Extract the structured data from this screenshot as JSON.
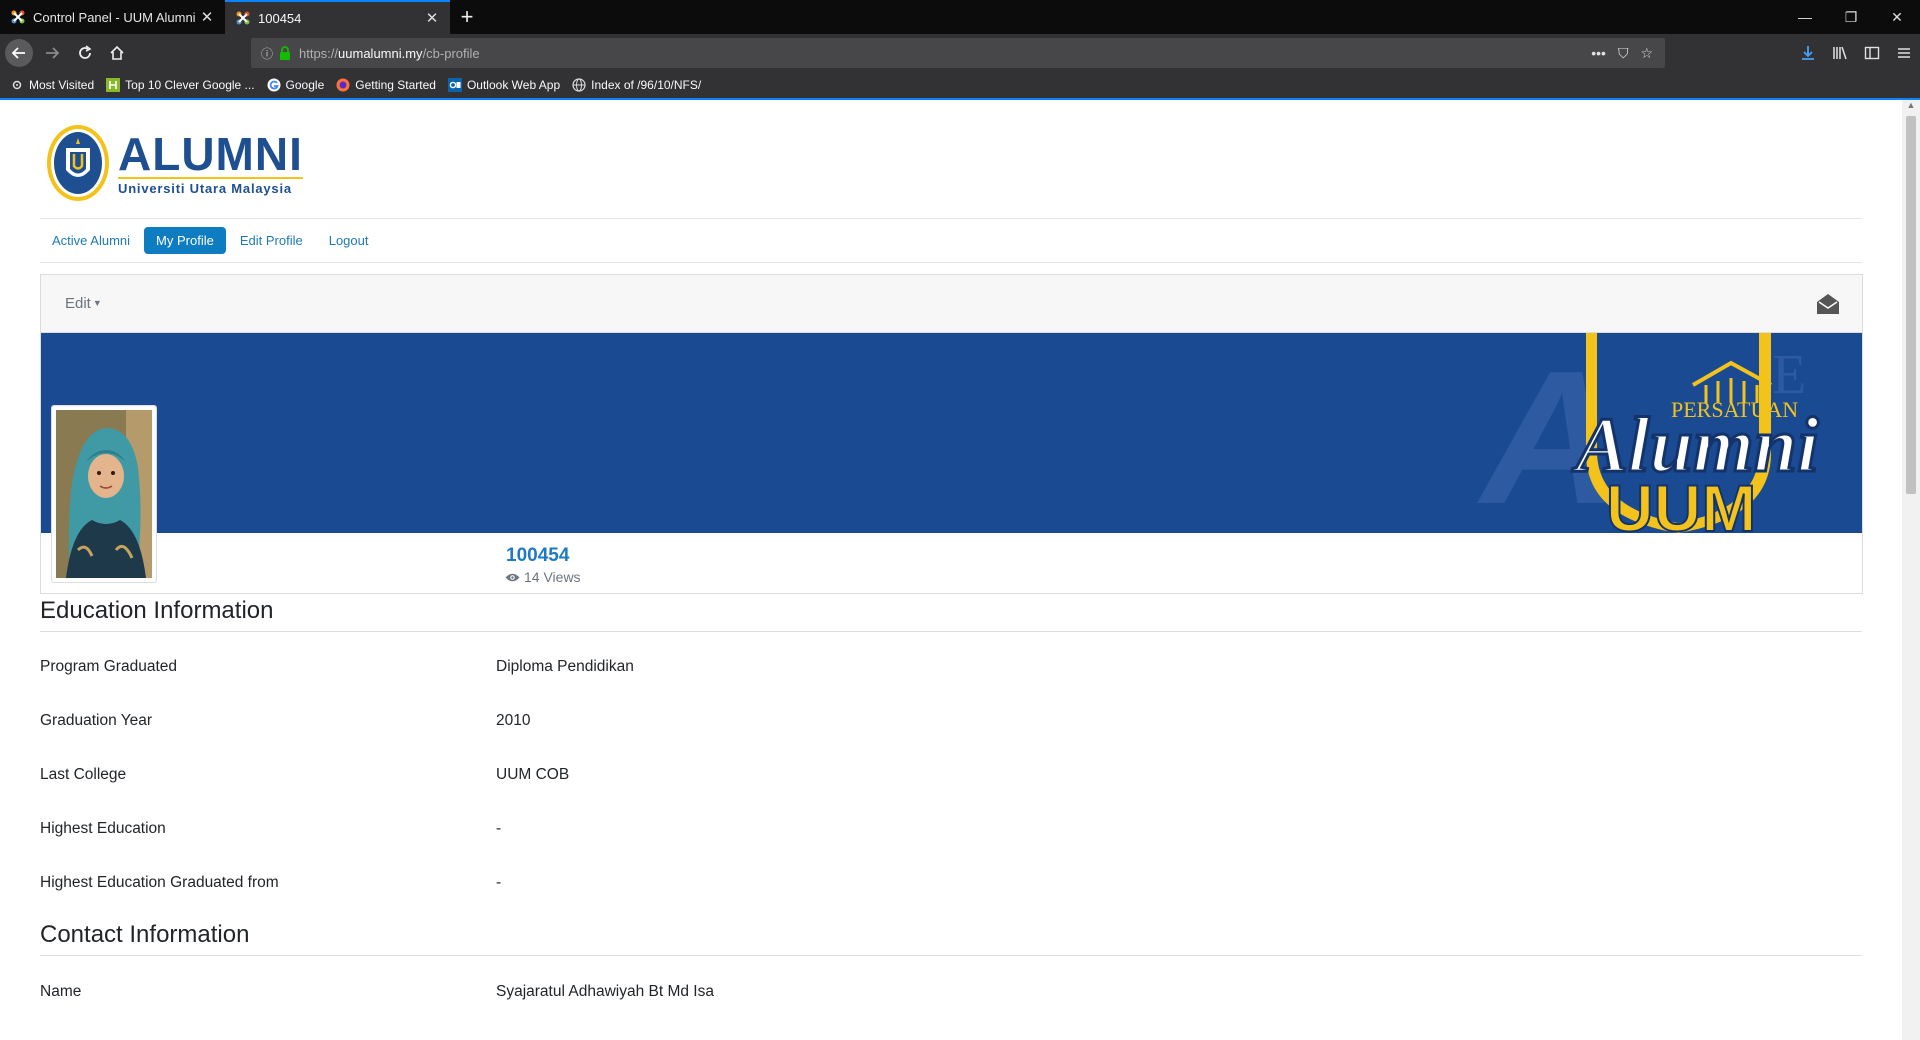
{
  "browser": {
    "tabs": [
      {
        "title": "Control Panel - UUM Alumni -",
        "active": false
      },
      {
        "title": "100454",
        "active": true
      }
    ],
    "new_tab": "+",
    "url_scheme": "https://",
    "url_host": "uumalumni.my",
    "url_path": "/cb-profile",
    "bookmarks": [
      {
        "label": "Most Visited",
        "icon": "gear-icon"
      },
      {
        "label": "Top 10 Clever Google ...",
        "icon": "h-icon"
      },
      {
        "label": "Google",
        "icon": "google-icon"
      },
      {
        "label": "Getting Started",
        "icon": "firefox-icon"
      },
      {
        "label": "Outlook Web App",
        "icon": "outlook-icon"
      },
      {
        "label": "Index of /96/10/NFS/",
        "icon": "globe-icon"
      }
    ]
  },
  "site": {
    "logo_main": "ALUMNI",
    "logo_sub": "Universiti Utara Malaysia"
  },
  "nav": {
    "items": [
      "Active Alumni",
      "My Profile",
      "Edit Profile",
      "Logout"
    ],
    "active": "My Profile"
  },
  "profile": {
    "edit_label": "Edit",
    "username": "100454",
    "views": "14 Views",
    "banner_text_top": "PERSATUAN",
    "banner_text_mid": "Alumni",
    "banner_text_bottom": "UUM"
  },
  "education": {
    "title": "Education Information",
    "rows": [
      {
        "label": "Program Graduated",
        "value": "Diploma Pendidikan"
      },
      {
        "label": "Graduation Year",
        "value": "2010"
      },
      {
        "label": "Last College",
        "value": "UUM COB"
      },
      {
        "label": "Highest Education",
        "value": "-"
      },
      {
        "label": "Highest Education Graduated from",
        "value": "-"
      }
    ]
  },
  "contact": {
    "title": "Contact Information",
    "rows": [
      {
        "label": "Name",
        "value": "Syajaratul Adhawiyah Bt Md Isa"
      }
    ]
  },
  "colors": {
    "brand_blue": "#1d4f91",
    "banner_blue": "#1a4a92",
    "active_tab": "#0e7cc1",
    "link": "#1f7ab8"
  }
}
